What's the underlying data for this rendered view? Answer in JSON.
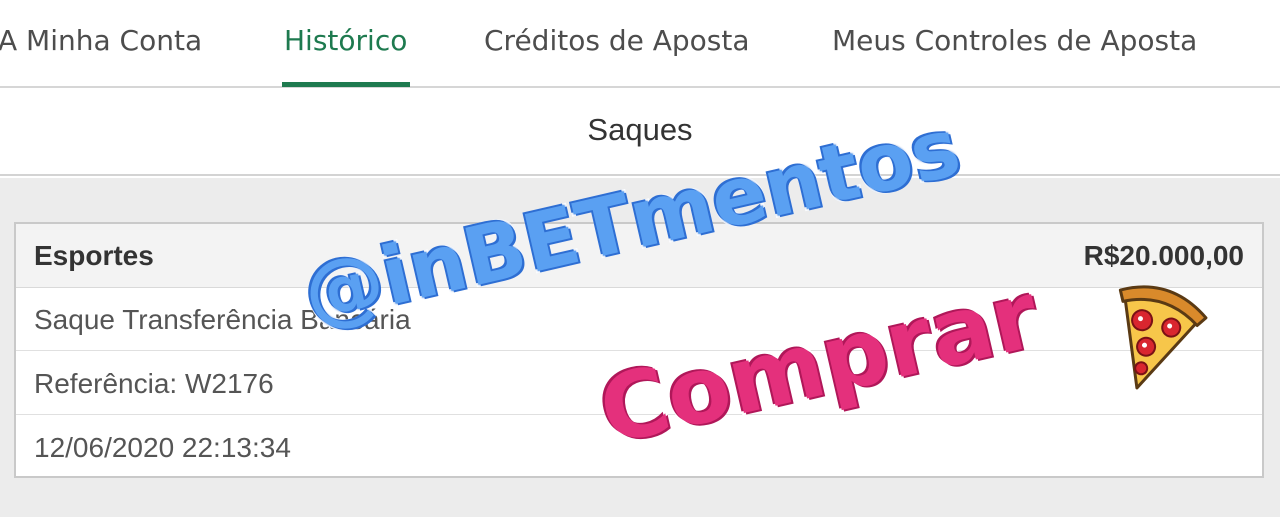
{
  "nav": {
    "tabs": [
      {
        "label": "A Minha Conta",
        "active": false
      },
      {
        "label": "Histórico",
        "active": true
      },
      {
        "label": "Créditos de Aposta",
        "active": false
      },
      {
        "label": "Meus Controles de Aposta",
        "active": false
      }
    ],
    "accent_color": "#1e7a4f"
  },
  "section": {
    "title": "Saques"
  },
  "transaction": {
    "category": "Esportes",
    "amount": "R$20.000,00",
    "method": "Saque Transferência Bancária",
    "reference": "Referência:  W2176",
    "datetime": "12/06/2020 22:13:34"
  },
  "overlay": {
    "handle": "@inBETmentos",
    "handle_color": "#5aa0f2",
    "buy_text": "Comprar",
    "buy_color": "#e4307c",
    "sticker_icon": "pizza-icon"
  }
}
